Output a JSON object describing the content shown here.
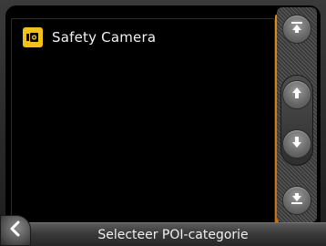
{
  "list": {
    "items": [
      {
        "label": "Safety Camera",
        "icon": "safety-camera-icon"
      }
    ]
  },
  "scroll": {
    "top_icon": "scroll-to-top-icon",
    "up_icon": "arrow-up-icon",
    "down_icon": "arrow-down-icon",
    "bottom_icon": "scroll-to-bottom-icon"
  },
  "header": {
    "back_icon": "back-chevron-icon",
    "title": "Selecteer POI-categorie"
  },
  "colors": {
    "accent": "#e08a16",
    "icon_bg": "#f2c21a",
    "text": "#f3f3f3"
  }
}
